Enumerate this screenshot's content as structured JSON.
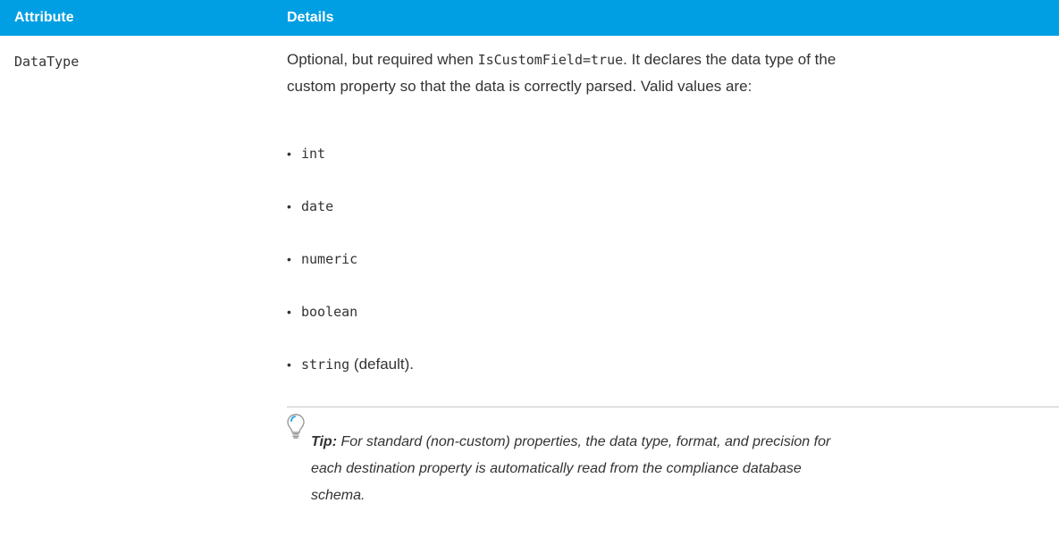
{
  "table": {
    "header": {
      "attribute": "Attribute",
      "details": "Details"
    },
    "row": {
      "attribute": "DataType",
      "intro": {
        "text_before_code": "Optional, but required when ",
        "code": "IsCustomField=true",
        "text_after_code": ". It declares the data type of the",
        "line2": "custom property so that the data is correctly parsed. Valid values are:"
      },
      "values": [
        {
          "code": "int",
          "suffix": ""
        },
        {
          "code": "date",
          "suffix": ""
        },
        {
          "code": "numeric",
          "suffix": ""
        },
        {
          "code": "boolean",
          "suffix": ""
        },
        {
          "code": "string",
          "suffix": " (default)."
        }
      ],
      "tip": {
        "label": "Tip:",
        "line1": " For standard (non-custom) properties, the data type, format, and precision for",
        "line2": "each destination property is automatically read from the compliance database",
        "line3": "schema."
      }
    }
  },
  "colors": {
    "header_bg": "#009fe3",
    "header_text": "#ffffff",
    "body_text": "#333333",
    "divider": "#c8c8c8",
    "tip_icon_accent": "#2aa8e0"
  },
  "icons": {
    "tip": "lightbulb-icon"
  }
}
